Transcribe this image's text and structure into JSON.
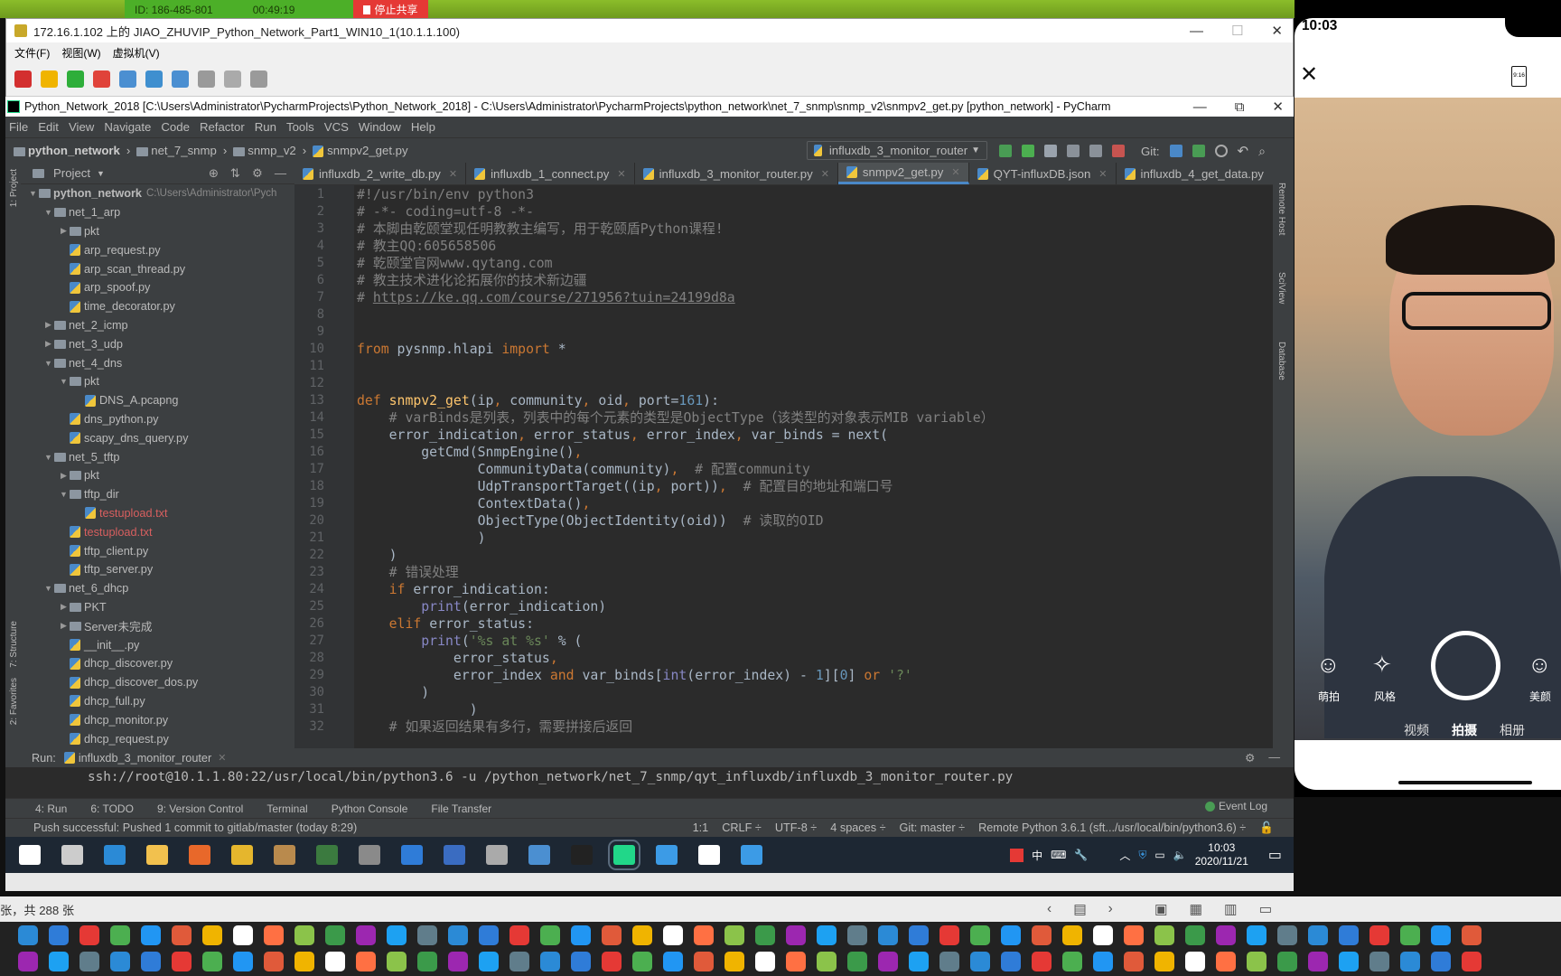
{
  "share_bar": {
    "id": "ID: 186-485-801",
    "timer": "00:49:19",
    "stop_label": "停止共享",
    "colors": {
      "green": "#4caf28",
      "red": "#e53935"
    }
  },
  "vmware": {
    "title": "172.16.1.102 上的 JIAO_ZHUVIP_Python_Network_Part1_WIN10_1(10.1.1.100)",
    "menu": [
      "文件(F)",
      "视图(W)",
      "虚拟机(V)"
    ],
    "toolbar": [
      {
        "name": "stop-icon",
        "color": "#d32f2f"
      },
      {
        "name": "pause-icon",
        "color": "#f0b400"
      },
      {
        "name": "play-icon",
        "color": "#2eae3a"
      },
      {
        "name": "reset-icon",
        "color": "#e0433a"
      },
      {
        "name": "snapshot-icon",
        "color": "#4b8fd1"
      },
      {
        "name": "revert-snapshot-icon",
        "color": "#3f8fcf"
      },
      {
        "name": "manage-snapshots-icon",
        "color": "#4b8fd1"
      },
      {
        "name": "send-keys-icon",
        "color": "#9a9a9a"
      },
      {
        "name": "settings-icon",
        "color": "#aaaaaa"
      },
      {
        "name": "usb-icon",
        "color": "#9a9a9a"
      }
    ]
  },
  "pycharm": {
    "title": "Python_Network_2018 [C:\\Users\\Administrator\\PycharmProjects\\Python_Network_2018] - C:\\Users\\Administrator\\PycharmProjects\\python_network\\net_7_snmp\\snmp_v2\\snmpv2_get.py [python_network] - PyCharm",
    "menu": [
      "File",
      "Edit",
      "View",
      "Navigate",
      "Code",
      "Refactor",
      "Run",
      "Tools",
      "VCS",
      "Window",
      "Help"
    ],
    "breadcrumb": [
      "python_network",
      "net_7_snmp",
      "snmp_v2",
      "snmpv2_get.py"
    ],
    "run_config": "influxdb_3_monitor_router",
    "git_label": "Git:",
    "project_label": "Project",
    "tree": [
      {
        "label": "python_network",
        "hint": "C:\\Users\\Administrator\\Pych",
        "depth": 0,
        "type": "open"
      },
      {
        "label": "net_1_arp",
        "depth": 1,
        "type": "open"
      },
      {
        "label": "pkt",
        "depth": 2,
        "type": "closed"
      },
      {
        "label": "arp_request.py",
        "depth": 2,
        "type": "file"
      },
      {
        "label": "arp_scan_thread.py",
        "depth": 2,
        "type": "file"
      },
      {
        "label": "arp_spoof.py",
        "depth": 2,
        "type": "file"
      },
      {
        "label": "time_decorator.py",
        "depth": 2,
        "type": "file"
      },
      {
        "label": "net_2_icmp",
        "depth": 1,
        "type": "closed"
      },
      {
        "label": "net_3_udp",
        "depth": 1,
        "type": "closed"
      },
      {
        "label": "net_4_dns",
        "depth": 1,
        "type": "open"
      },
      {
        "label": "pkt",
        "depth": 2,
        "type": "open"
      },
      {
        "label": "DNS_A.pcapng",
        "depth": 3,
        "type": "file"
      },
      {
        "label": "dns_python.py",
        "depth": 2,
        "type": "file"
      },
      {
        "label": "scapy_dns_query.py",
        "depth": 2,
        "type": "file"
      },
      {
        "label": "net_5_tftp",
        "depth": 1,
        "type": "open"
      },
      {
        "label": "pkt",
        "depth": 2,
        "type": "closed"
      },
      {
        "label": "tftp_dir",
        "depth": 2,
        "type": "open"
      },
      {
        "label": "testupload.txt",
        "depth": 3,
        "type": "file",
        "red": true
      },
      {
        "label": "testupload.txt",
        "depth": 2,
        "type": "file",
        "red": true
      },
      {
        "label": "tftp_client.py",
        "depth": 2,
        "type": "file"
      },
      {
        "label": "tftp_server.py",
        "depth": 2,
        "type": "file"
      },
      {
        "label": "net_6_dhcp",
        "depth": 1,
        "type": "open"
      },
      {
        "label": "PKT",
        "depth": 2,
        "type": "closed"
      },
      {
        "label": "Server未完成",
        "depth": 2,
        "type": "closed"
      },
      {
        "label": "__init__.py",
        "depth": 2,
        "type": "file"
      },
      {
        "label": "dhcp_discover.py",
        "depth": 2,
        "type": "file"
      },
      {
        "label": "dhcp_discover_dos.py",
        "depth": 2,
        "type": "file"
      },
      {
        "label": "dhcp_full.py",
        "depth": 2,
        "type": "file"
      },
      {
        "label": "dhcp_monitor.py",
        "depth": 2,
        "type": "file"
      },
      {
        "label": "dhcp_request.py",
        "depth": 2,
        "type": "file"
      }
    ],
    "tabs": [
      {
        "label": "influxdb_2_write_db.py",
        "active": false
      },
      {
        "label": "influxdb_1_connect.py",
        "active": false
      },
      {
        "label": "influxdb_3_monitor_router.py",
        "active": false
      },
      {
        "label": "snmpv2_get.py",
        "active": true
      },
      {
        "label": "QYT-influxDB.json",
        "active": false
      },
      {
        "label": "influxdb_4_get_data.py",
        "active": false
      }
    ],
    "left_tools": [
      "1: Project",
      "7: Structure",
      "2: Favorites"
    ],
    "right_tools": [
      "Remote Host",
      "SciView",
      "Database"
    ],
    "code": [
      [
        [
          "c",
          "#!/usr/bin/env python3"
        ]
      ],
      [
        [
          "c",
          "# -*- coding=utf-8 -*-"
        ]
      ],
      [
        [
          "c",
          "# 本脚由乾颐堂现任明教教主编写，用于乾颐盾Python课程!"
        ]
      ],
      [
        [
          "c",
          "# 教主QQ:605658506"
        ]
      ],
      [
        [
          "c",
          "# 乾颐堂官网www.qytang.com"
        ]
      ],
      [
        [
          "c",
          "# 教主技术进化论拓展你的技术新边疆"
        ]
      ],
      [
        [
          "c",
          "# "
        ],
        [
          "u",
          "https://ke.qq.com/course/271956?tuin=24199d8a"
        ]
      ],
      [],
      [],
      [
        [
          "k",
          "from"
        ],
        [
          "d",
          " pysnmp.hlapi "
        ],
        [
          "k",
          "import"
        ],
        [
          "d",
          " *"
        ]
      ],
      [],
      [],
      [
        [
          "k",
          "def "
        ],
        [
          "f",
          "snmpv2_get"
        ],
        [
          "d",
          "(ip"
        ],
        [
          "k",
          ","
        ],
        [
          "d",
          " community"
        ],
        [
          "k",
          ","
        ],
        [
          "d",
          " oid"
        ],
        [
          "k",
          ","
        ],
        [
          "d",
          " port="
        ],
        [
          "n",
          "161"
        ],
        [
          "d",
          "):"
        ]
      ],
      [
        [
          "c",
          "    # varBinds是列表，列表中的每个元素的类型是ObjectType（该类型的对象表示MIB variable）"
        ]
      ],
      [
        [
          "d",
          "    error_indication"
        ],
        [
          "k",
          ","
        ],
        [
          "d",
          " error_status"
        ],
        [
          "k",
          ","
        ],
        [
          "d",
          " error_index"
        ],
        [
          "k",
          ","
        ],
        [
          "d",
          " var_binds = next("
        ]
      ],
      [
        [
          "d",
          "        getCmd(SnmpEngine()"
        ],
        [
          "k",
          ","
        ]
      ],
      [
        [
          "d",
          "               CommunityData(community)"
        ],
        [
          "k",
          ","
        ],
        [
          "c",
          "  # 配置community"
        ]
      ],
      [
        [
          "d",
          "               UdpTransportTarget((ip"
        ],
        [
          "k",
          ","
        ],
        [
          "d",
          " port))"
        ],
        [
          "k",
          ","
        ],
        [
          "c",
          "  # 配置目的地址和端口号"
        ]
      ],
      [
        [
          "d",
          "               ContextData()"
        ],
        [
          "k",
          ","
        ]
      ],
      [
        [
          "d",
          "               ObjectType(ObjectIdentity(oid))"
        ],
        [
          "c",
          "  # 读取的OID"
        ]
      ],
      [
        [
          "d",
          "               )"
        ]
      ],
      [
        [
          "d",
          "    )"
        ]
      ],
      [
        [
          "c",
          "    # 错误处理"
        ]
      ],
      [
        [
          "k",
          "    if"
        ],
        [
          "d",
          " error_indication:"
        ]
      ],
      [
        [
          "b",
          "        print"
        ],
        [
          "d",
          "(error_indication)"
        ]
      ],
      [
        [
          "k",
          "    elif"
        ],
        [
          "d",
          " error_status:"
        ]
      ],
      [
        [
          "b",
          "        print"
        ],
        [
          "d",
          "("
        ],
        [
          "s",
          "'%s at %s'"
        ],
        [
          "d",
          " % ("
        ]
      ],
      [
        [
          "d",
          "            error_status"
        ],
        [
          "k",
          ","
        ]
      ],
      [
        [
          "d",
          "            error_index "
        ],
        [
          "k",
          "and"
        ],
        [
          "d",
          " var_binds["
        ],
        [
          "b",
          "int"
        ],
        [
          "d",
          "(error_index) - "
        ],
        [
          "n",
          "1"
        ],
        [
          "d",
          "]["
        ],
        [
          "n",
          "0"
        ],
        [
          "d",
          "] "
        ],
        [
          "k",
          "or"
        ],
        [
          "s",
          " '?'"
        ]
      ],
      [
        [
          "d",
          "        )"
        ]
      ],
      [
        [
          "d",
          "              )"
        ]
      ],
      [
        [
          "c",
          "    # 如果返回结果有多行，需要拼接后返回"
        ]
      ]
    ],
    "run": {
      "label": "Run:",
      "tab": "influxdb_3_monitor_router",
      "command": "ssh://root@10.1.1.80:22/usr/local/bin/python3.6 -u /python_network/net_7_snmp/qyt_influxdb/influxdb_3_monitor_router.py"
    },
    "tool_windows": [
      "4: Run",
      "6: TODO",
      "9: Version Control",
      "Terminal",
      "Python Console",
      "File Transfer"
    ],
    "event_log": "Event Log",
    "status": {
      "message": "Push successful: Pushed 1 commit to gitlab/master (today 8:29)",
      "position": "1:1",
      "line_sep": "CRLF ÷",
      "encoding": "UTF-8 ÷",
      "indent": "4 spaces ÷",
      "git": "Git: master ÷",
      "interpreter": "Remote Python 3.6.1 (sft.../usr/local/bin/python3.6) ÷"
    }
  },
  "windows_taskbar": {
    "apps": [
      {
        "name": "start-icon",
        "color": "#ffffff"
      },
      {
        "name": "task-view-icon",
        "color": "#cccccc"
      },
      {
        "name": "edge-icon",
        "color": "#2b8ad6"
      },
      {
        "name": "file-explorer-icon",
        "color": "#f2c14e"
      },
      {
        "name": "firefox-icon",
        "color": "#e8682a"
      },
      {
        "name": "chrome-icon",
        "color": "#e5b62d"
      },
      {
        "name": "app-icon",
        "color": "#b98a4d"
      },
      {
        "name": "app-icon",
        "color": "#3b7a3f"
      },
      {
        "name": "app-icon",
        "color": "#8a8a8a"
      },
      {
        "name": "app-icon",
        "color": "#2f7cd8"
      },
      {
        "name": "search-tool-icon",
        "color": "#3a6cc1"
      },
      {
        "name": "database-icon",
        "color": "#aaaaaa"
      },
      {
        "name": "app-icon",
        "color": "#4b8fd1"
      },
      {
        "name": "terminal-icon",
        "color": "#222222"
      },
      {
        "name": "pycharm-icon",
        "color": "#21d789"
      },
      {
        "name": "app-icon",
        "color": "#3c9be6"
      },
      {
        "name": "settings-icon",
        "color": "#ffffff"
      },
      {
        "name": "remote-desktop-icon",
        "color": "#3c9be6"
      }
    ],
    "ime": "中",
    "time": "10:03",
    "date": "2020/11/21"
  },
  "viewer": {
    "count_text": "张，共 288 张"
  },
  "phone": {
    "time": "10:03",
    "ratio": "9:16",
    "modes": [
      "视频",
      "拍摄",
      "相册"
    ],
    "tools": [
      "萌拍",
      "风格",
      "美颜"
    ]
  }
}
